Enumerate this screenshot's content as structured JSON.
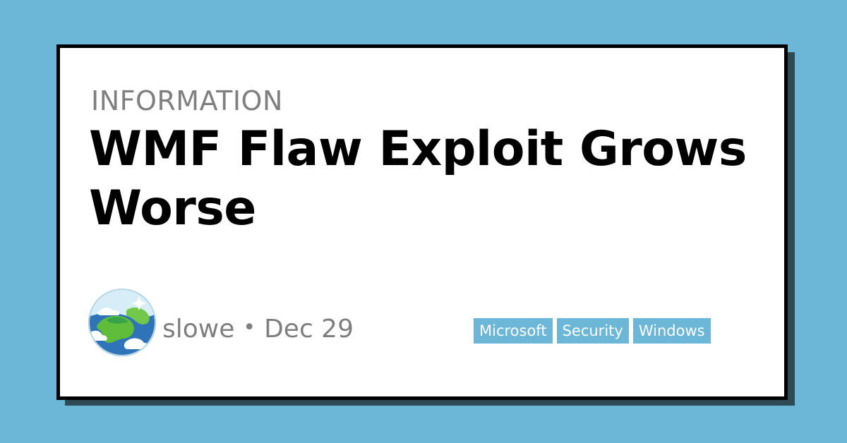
{
  "post": {
    "category": "INFORMATION",
    "title": "WMF Flaw Exploit Grows Worse",
    "author": "slowe",
    "separator": "•",
    "date": "Dec 29",
    "tags": [
      "Microsoft",
      "Security",
      "Windows"
    ]
  },
  "colors": {
    "background": "#6cb6d8",
    "shadow": "#2e4a55",
    "card": "#ffffff",
    "border": "#000000",
    "muted_text": "#7f7f7f",
    "tag_background": "#6cb6d8",
    "tag_text": "#ffffff"
  },
  "avatar": {
    "icon": "earth-globe-icon"
  }
}
